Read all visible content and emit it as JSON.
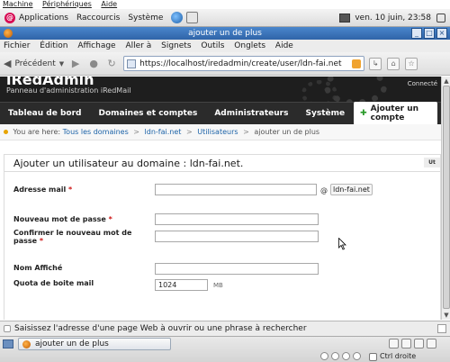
{
  "vm_menu": [
    "Machine",
    "Périphériques",
    "Aide"
  ],
  "panel": {
    "applications": "Applications",
    "shortcuts": "Raccourcis",
    "system": "Système",
    "clock": "ven. 10 juin, 23:58"
  },
  "window": {
    "title": "ajouter un de plus"
  },
  "menubar": [
    "Fichier",
    "Édition",
    "Affichage",
    "Aller à",
    "Signets",
    "Outils",
    "Onglets",
    "Aide"
  ],
  "nav": {
    "back_label": "Précédent",
    "url": "https://localhost/iredadmin/create/user/ldn-fai.net"
  },
  "site": {
    "logo": "iRedAdmin",
    "subtitle": "Panneau d'administration iRedMail",
    "connected": "Connecté"
  },
  "tabs": [
    "Tableau de bord",
    "Domaines et comptes",
    "Administrateurs",
    "Système"
  ],
  "add_account_label": "Ajouter un compte",
  "breadcrumb": {
    "prefix": "You are here:",
    "items": [
      "Tous les domaines",
      "ldn-fai.net",
      "Utilisateurs"
    ],
    "current": "ajouter un de plus"
  },
  "form": {
    "title": "Ajouter un utilisateur au domaine : ldn-fai.net.",
    "head_tag": "Ut",
    "email_label": "Adresse mail",
    "at_sign": "@",
    "domain": "ldn-fai.net",
    "password_label": "Nouveau mot de passe",
    "confirm_label_1": "Confirmer le nouveau mot de",
    "confirm_label_2": "passe",
    "display_name_label": "Nom Affiché",
    "quota_label": "Quota de boite mail",
    "quota_value": "1024",
    "quota_unit": "MB",
    "required_mark": "*"
  },
  "statusbar": {
    "text": "Saisissez l'adresse d'une page Web à ouvrir ou une phrase à rechercher"
  },
  "taskbar": {
    "task_label": "ajouter un de plus",
    "right_ctrl": "Ctrl droite"
  }
}
